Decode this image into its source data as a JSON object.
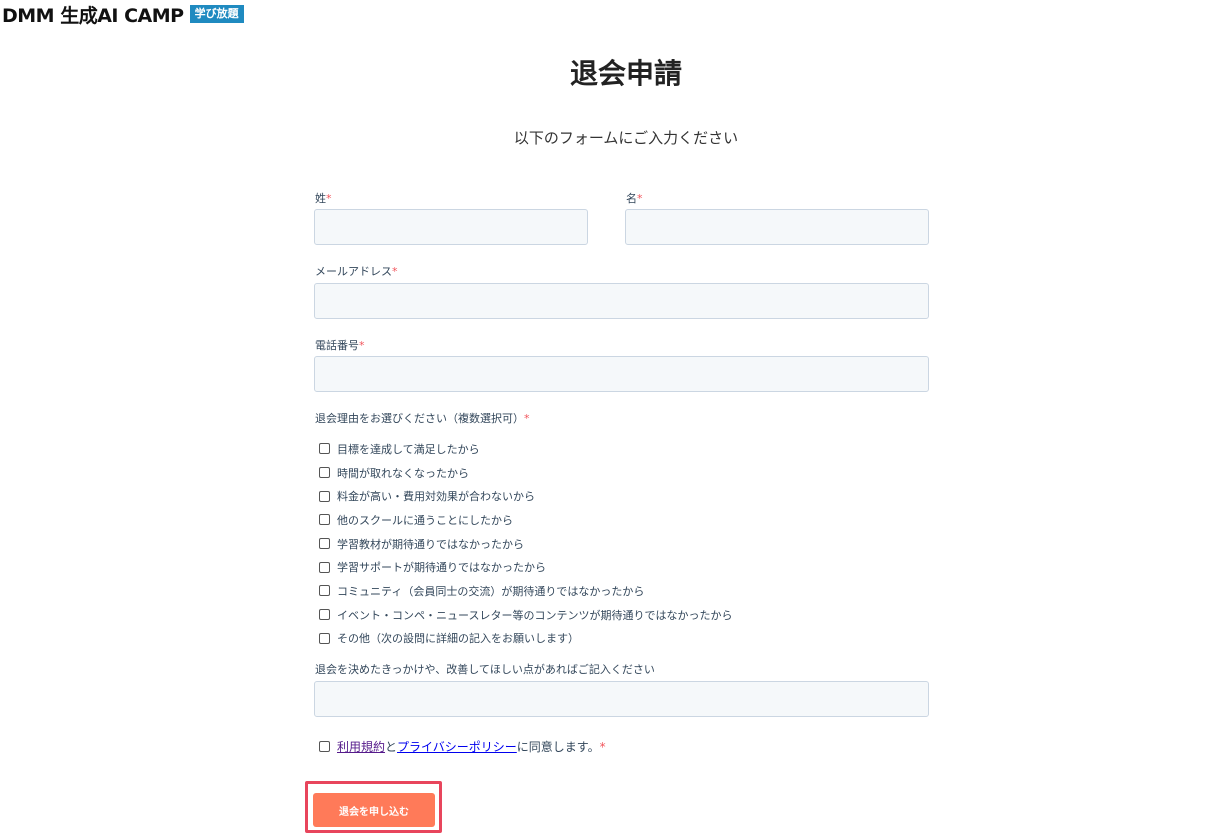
{
  "logo": {
    "text": "DMM 生成AI CAMP",
    "badge": "学び放題",
    "badge_color": "#1f8ac0"
  },
  "page": {
    "title": "退会申請",
    "subtitle": "以下のフォームにご入力ください"
  },
  "form": {
    "required_mark": "*",
    "last_name": {
      "label": "姓",
      "value": ""
    },
    "first_name": {
      "label": "名",
      "value": ""
    },
    "email": {
      "label": "メールアドレス",
      "value": ""
    },
    "phone": {
      "label": "電話番号",
      "value": ""
    },
    "reasons": {
      "label": "退会理由をお選びください（複数選択可）",
      "options": [
        "目標を達成して満足したから",
        "時間が取れなくなったから",
        "料金が高い・費用対効果が合わないから",
        "他のスクールに通うことにしたから",
        "学習教材が期待通りではなかったから",
        "学習サポートが期待通りではなかったから",
        "コミュニティ（会員同士の交流）が期待通りではなかったから",
        "イベント・コンペ・ニュースレター等のコンテンツが期待通りではなかったから",
        "その他（次の設問に詳細の記入をお願いします）"
      ]
    },
    "feedback": {
      "label": "退会を決めたきっかけや、改善してほしい点があればご記入ください",
      "value": ""
    },
    "agreement": {
      "terms_link": "利用規約",
      "and": "と",
      "privacy_link": "プライバシーポリシー",
      "suffix": "に同意します。"
    },
    "submit_label": "退会を申し込む"
  },
  "colors": {
    "accent": "#ff7a59",
    "required": "#f2545b",
    "highlight": "#e8455c",
    "input_bg": "#f5f8fa"
  }
}
